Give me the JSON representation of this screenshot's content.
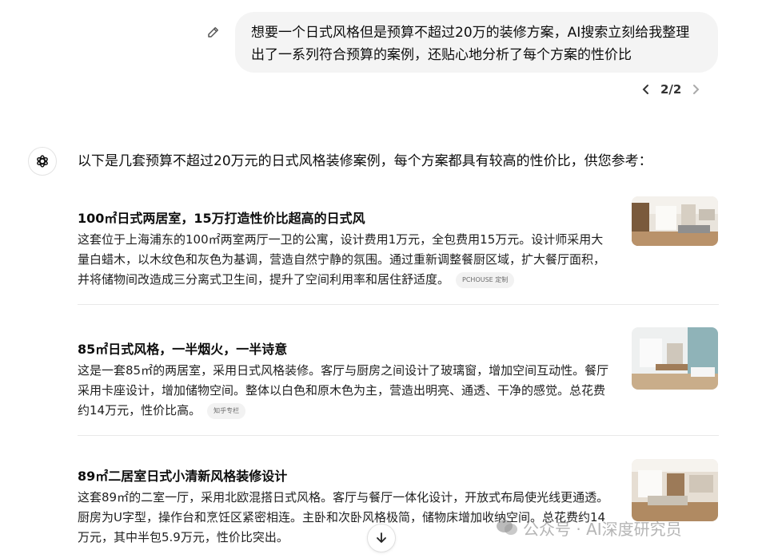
{
  "user_message": {
    "text": "想要一个日式风格但是预算不超过20万的装修方案，AI搜索立刻给我整理出了一系列符合预算的案例，还贴心地分析了每个方案的性价比",
    "pager": "2/2"
  },
  "assistant": {
    "intro": "以下是几套预算不超过20万元的日式风格装修案例，每个方案都具有较高的性价比，供您参考：",
    "cards": [
      {
        "title": "100㎡日式两居室，15万打造性价比超高的日式风",
        "desc": "这套位于上海浦东的100㎡两室两厅一卫的公寓，设计费用1万元，全包费用15万元。设计师采用大量白蜡木，以木纹色和灰色为基调，营造自然宁静的氛围。通过重新调整餐厨区域，扩大餐厅面积，并将储物间改造成三分离式卫生间，提升了空间利用率和居住舒适度。",
        "source": "PCHOUSE 定制"
      },
      {
        "title": "85㎡日式风格，一半烟火，一半诗意",
        "desc": "这是一套85㎡的两居室，采用日式风格装修。客厅与厨房之间设计了玻璃窗，增加空间互动性。餐厅采用卡座设计，增加储物空间。整体以白色和原木色为主，营造出明亮、通透、干净的感觉。总花费约14万元，性价比高。",
        "source": "知乎专栏"
      },
      {
        "title": "89㎡二居室日式小清新风格装修设计",
        "desc": "这套89㎡的二室一厅，采用北欧混搭日式风格。客厅与餐厅一体化设计，开放式布局使光线更通透。厨房为U字型，操作台和烹饪区紧密相连。主卧和次卧风格极简，储物床增加收纳空间。总花费约14万元，其中半包5.9万元，性价比突出。",
        "source": ""
      }
    ]
  },
  "watermark": "公众号 · AI深度研究员"
}
